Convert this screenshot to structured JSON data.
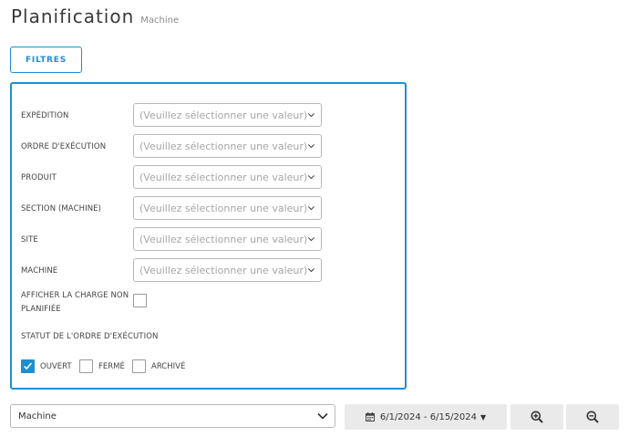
{
  "header": {
    "title": "Planification",
    "subtitle": "Machine"
  },
  "filters_button": {
    "label": "FILTRES"
  },
  "fields": [
    {
      "label": "EXPÉDITION",
      "placeholder": "(Veuillez sélectionner une valeur)"
    },
    {
      "label": "ORDRE D'EXÉCUTION",
      "placeholder": "(Veuillez sélectionner une valeur)"
    },
    {
      "label": "PRODUIT",
      "placeholder": "(Veuillez sélectionner une valeur)"
    },
    {
      "label": "SECTION (MACHINE)",
      "placeholder": "(Veuillez sélectionner une valeur)"
    },
    {
      "label": "SITE",
      "placeholder": "(Veuillez sélectionner une valeur)"
    },
    {
      "label": "MACHINE",
      "placeholder": "(Veuillez sélectionner une valeur)"
    }
  ],
  "unplanned_load": {
    "label_line1": "AFFICHER LA CHARGE NON",
    "label_line2": "PLANIFIÉE",
    "checked": false
  },
  "status": {
    "label": "STATUT DE L'ORDRE D'EXÉCUTION",
    "options": [
      {
        "label": "OUVERT",
        "checked": true
      },
      {
        "label": "FERMÉ",
        "checked": false
      },
      {
        "label": "ARCHIVÉ",
        "checked": false
      }
    ]
  },
  "view_select": {
    "value": "Machine"
  },
  "date_range": {
    "value": "6/1/2024 - 6/15/2024"
  },
  "icons": {
    "zoom_in": "zoom-in-icon",
    "zoom_out": "zoom-out-icon",
    "calendar": "calendar-icon",
    "chevron": "chevron-down-icon"
  },
  "colors": {
    "accent": "#1c8fd1",
    "button_bg": "#eaeaea"
  }
}
